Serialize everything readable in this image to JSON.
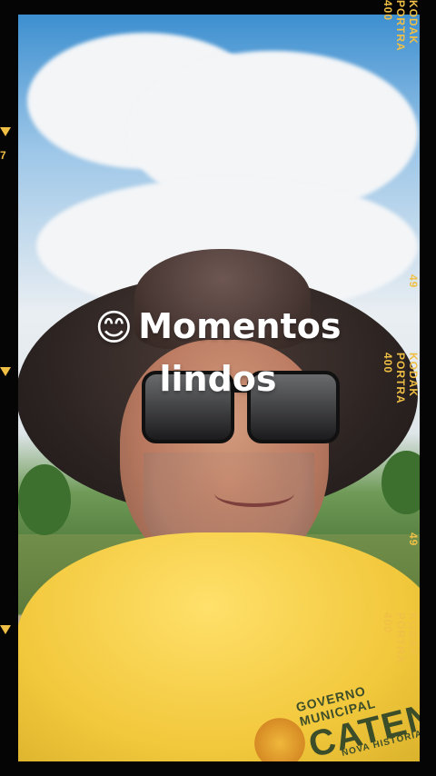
{
  "caption": {
    "emoji": "😊",
    "line1": "Momentos",
    "line2": "lindos"
  },
  "film_markings": {
    "top_right": "KODAK PORTRA 400",
    "middle_right_number": "49",
    "middle_right_text": "KODAK PORTRA 400",
    "lower_right_number": "49",
    "bottom_right_text": "KODAK PORTRA 400",
    "left_top_number": "7"
  },
  "shirt_print": {
    "top": "GOVERNO MUNICIPAL",
    "main": "CATENDE",
    "bottom": "NOVA HISTÓRIA"
  }
}
